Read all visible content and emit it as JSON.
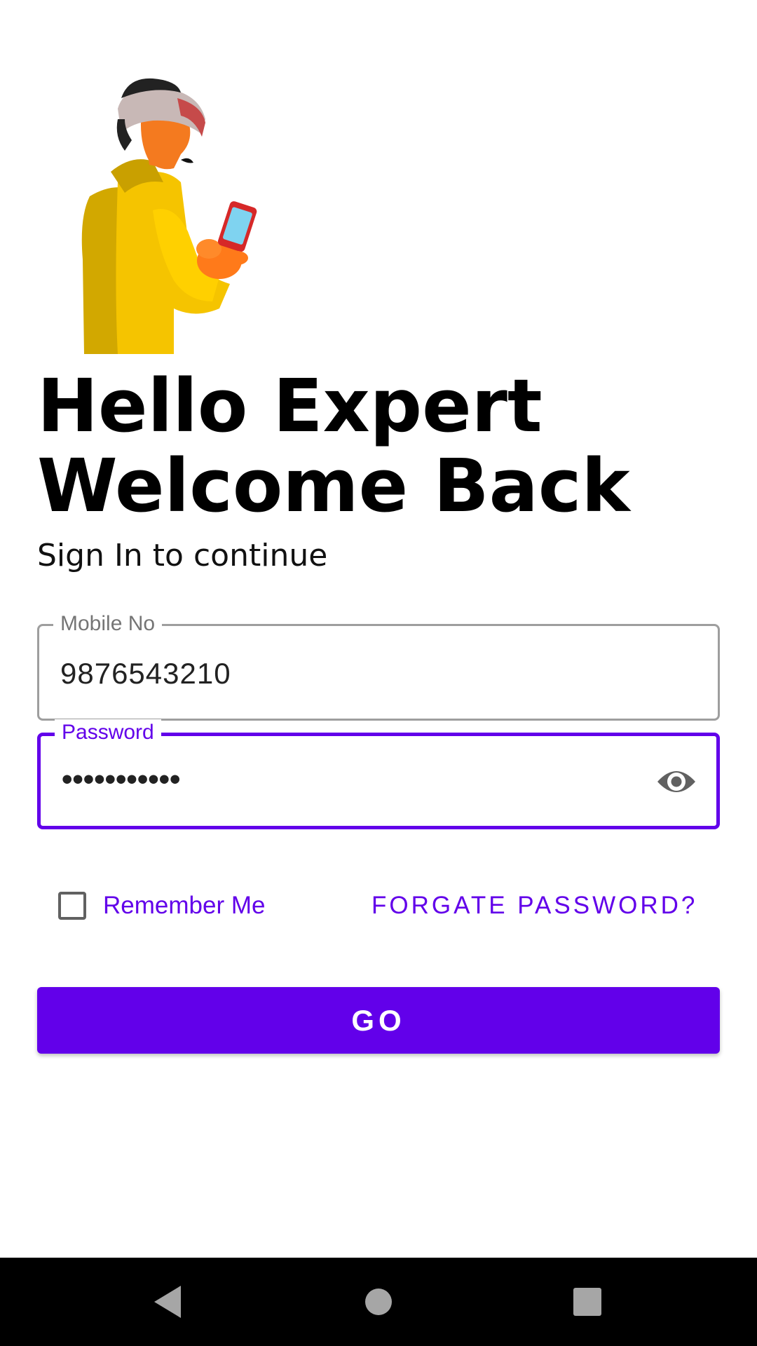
{
  "colors": {
    "accent": "#6200ea",
    "outline_inactive": "#9e9e9e",
    "text_primary": "#000000",
    "nav_background": "#000000",
    "nav_icon": "#a6a6a6"
  },
  "illustration": {
    "icon": "man-holding-phone-illustration"
  },
  "heading": {
    "line1": "Hello Expert",
    "line2": "Welcome Back"
  },
  "subtitle": "Sign In to continue",
  "form": {
    "mobile": {
      "label": "Mobile No",
      "value": "9876543210"
    },
    "password": {
      "label": "Password",
      "value": "•••••••••••",
      "toggle_icon": "eye-icon"
    },
    "remember_me": {
      "label": "Remember Me",
      "checked": false
    },
    "forgot_password": "FORGATE PASSWORD?",
    "submit": "GO"
  },
  "nav_bar": {
    "icons": [
      "back-icon",
      "home-icon",
      "recents-icon"
    ]
  }
}
